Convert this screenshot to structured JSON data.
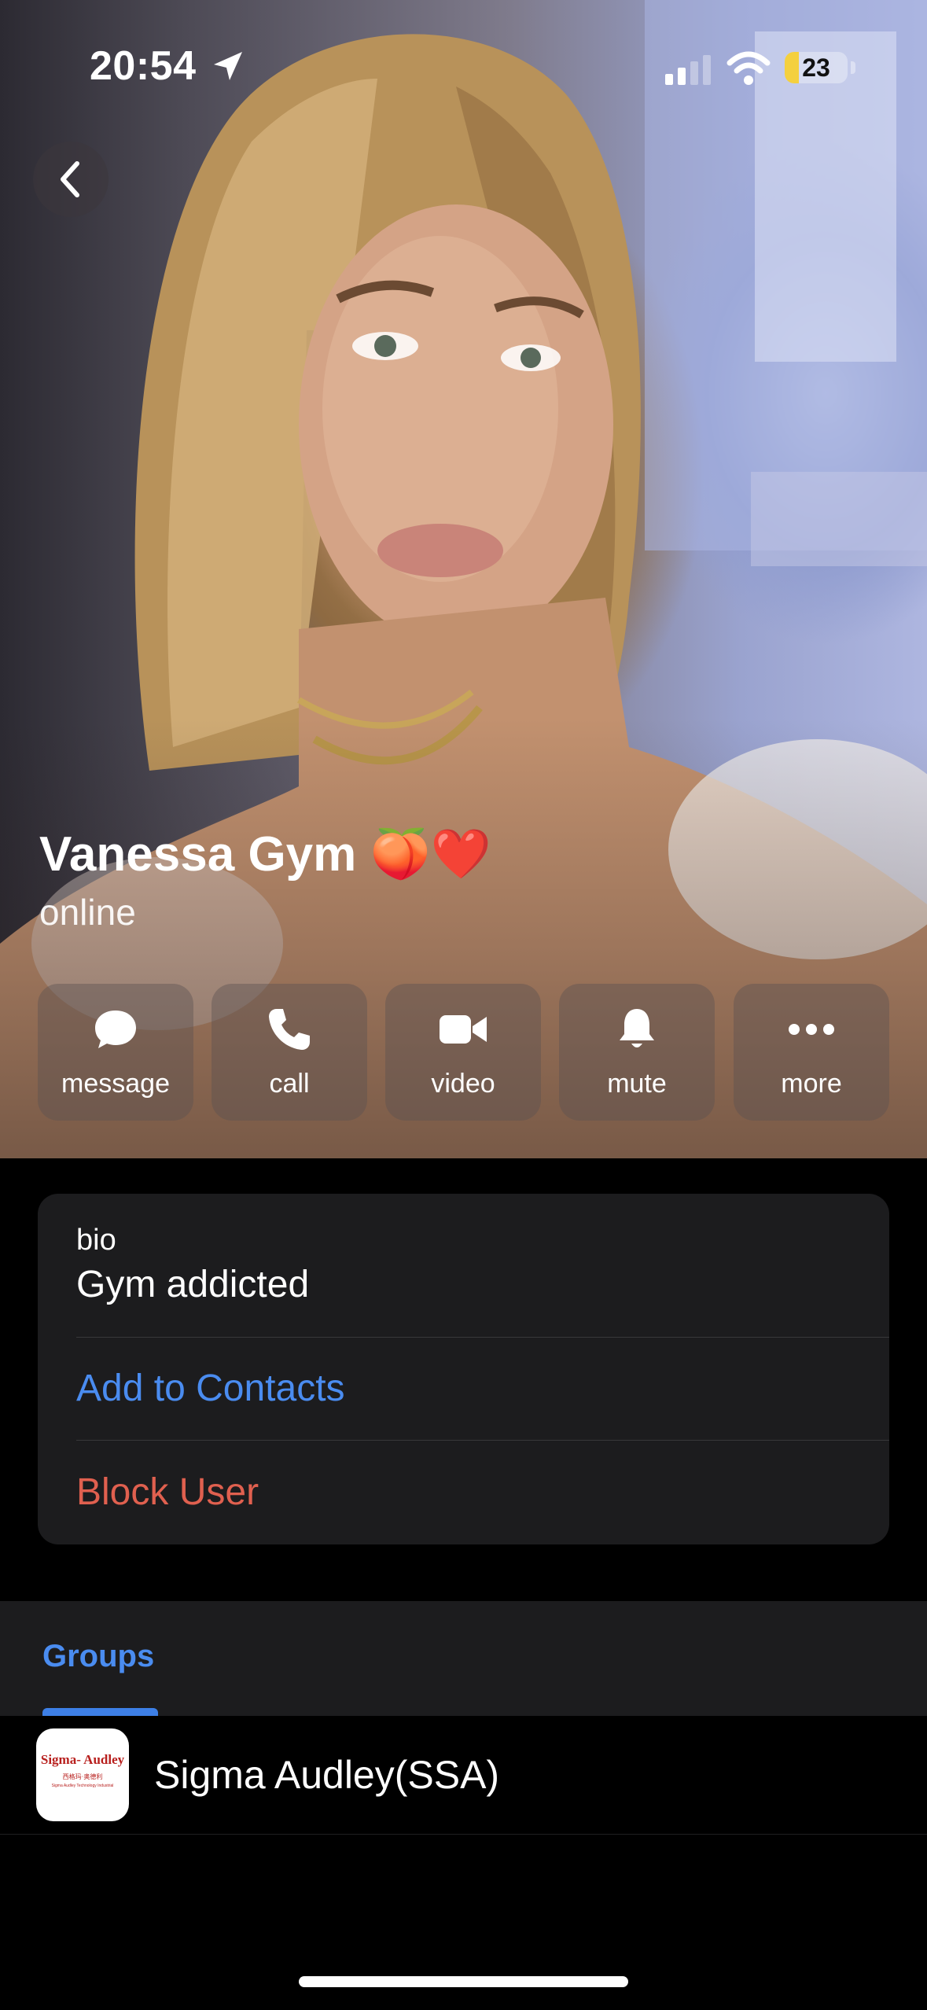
{
  "status_bar": {
    "time": "20:54",
    "battery_level": "23",
    "battery_color": "#f4d03f"
  },
  "profile": {
    "name": "Vanessa Gym 🍑❤️",
    "status": "online"
  },
  "actions": [
    {
      "label": "message",
      "icon": "message-icon"
    },
    {
      "label": "call",
      "icon": "phone-icon"
    },
    {
      "label": "video",
      "icon": "video-icon"
    },
    {
      "label": "mute",
      "icon": "bell-icon"
    },
    {
      "label": "more",
      "icon": "more-icon"
    }
  ],
  "info": {
    "bio_label": "bio",
    "bio_text": "Gym addicted",
    "add_contact": "Add to Contacts",
    "block_user": "Block User"
  },
  "groups": {
    "tab_label": "Groups",
    "items": [
      {
        "name": "Sigma Audley(SSA)",
        "avatar_text": "Sigma- Audley",
        "avatar_subtext": "西格玛·奥德利",
        "avatar_subtext2": "Sigma Audley Technology Industrial"
      }
    ]
  },
  "colors": {
    "link_blue": "#4a8cf0",
    "destructive_red": "#e0604f",
    "card_bg": "#1c1c1e"
  }
}
